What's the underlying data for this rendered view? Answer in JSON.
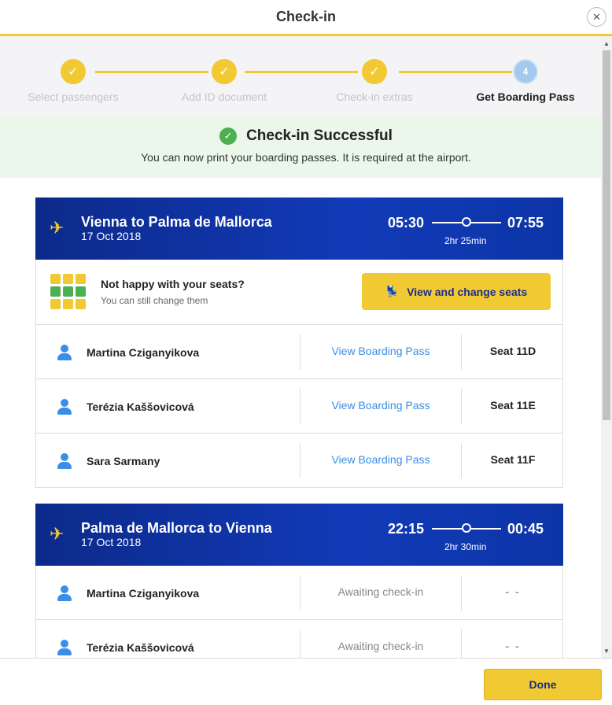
{
  "header": {
    "title": "Check-in",
    "close_icon": "close-icon"
  },
  "stepper": {
    "steps": [
      {
        "label": "Select passengers",
        "state": "done"
      },
      {
        "label": "Add ID document",
        "state": "done"
      },
      {
        "label": "Check-in extras",
        "state": "done"
      },
      {
        "label": "Get Boarding Pass",
        "state": "current",
        "number": "4"
      }
    ],
    "check_glyph": "✓"
  },
  "success": {
    "title": "Check-in Successful",
    "subtitle": "You can now print your boarding passes. It is required at the airport."
  },
  "flights": [
    {
      "route": "Vienna to Palma de Mallorca",
      "date": "17 Oct 2018",
      "departure": "05:30",
      "arrival": "07:55",
      "duration": "2hr 25min",
      "seats_prompt": {
        "title": "Not happy with your seats?",
        "subtitle": "You can still change them",
        "button": "View and change seats"
      },
      "passengers": [
        {
          "name": "Martina Cziganyikova",
          "action": "View Boarding Pass",
          "seat": "Seat 11D"
        },
        {
          "name": "Terézia Kaššovicová",
          "action": "View Boarding Pass",
          "seat": "Seat 11E"
        },
        {
          "name": "Sara Sarmany",
          "action": "View Boarding Pass",
          "seat": "Seat 11F"
        }
      ]
    },
    {
      "route": "Palma de Mallorca to Vienna",
      "date": "17 Oct 2018",
      "departure": "22:15",
      "arrival": "00:45",
      "duration": "2hr 30min",
      "passengers": [
        {
          "name": "Martina Cziganyikova",
          "action": "Awaiting check-in",
          "seat": "- -"
        },
        {
          "name": "Terézia Kaššovicová",
          "action": "Awaiting check-in",
          "seat": "- -"
        }
      ]
    }
  ],
  "footer": {
    "done_label": "Done"
  },
  "colors": {
    "accent": "#f1c933",
    "brand": "#123ab8",
    "link": "#3a8ee6",
    "success": "#4caf50"
  }
}
